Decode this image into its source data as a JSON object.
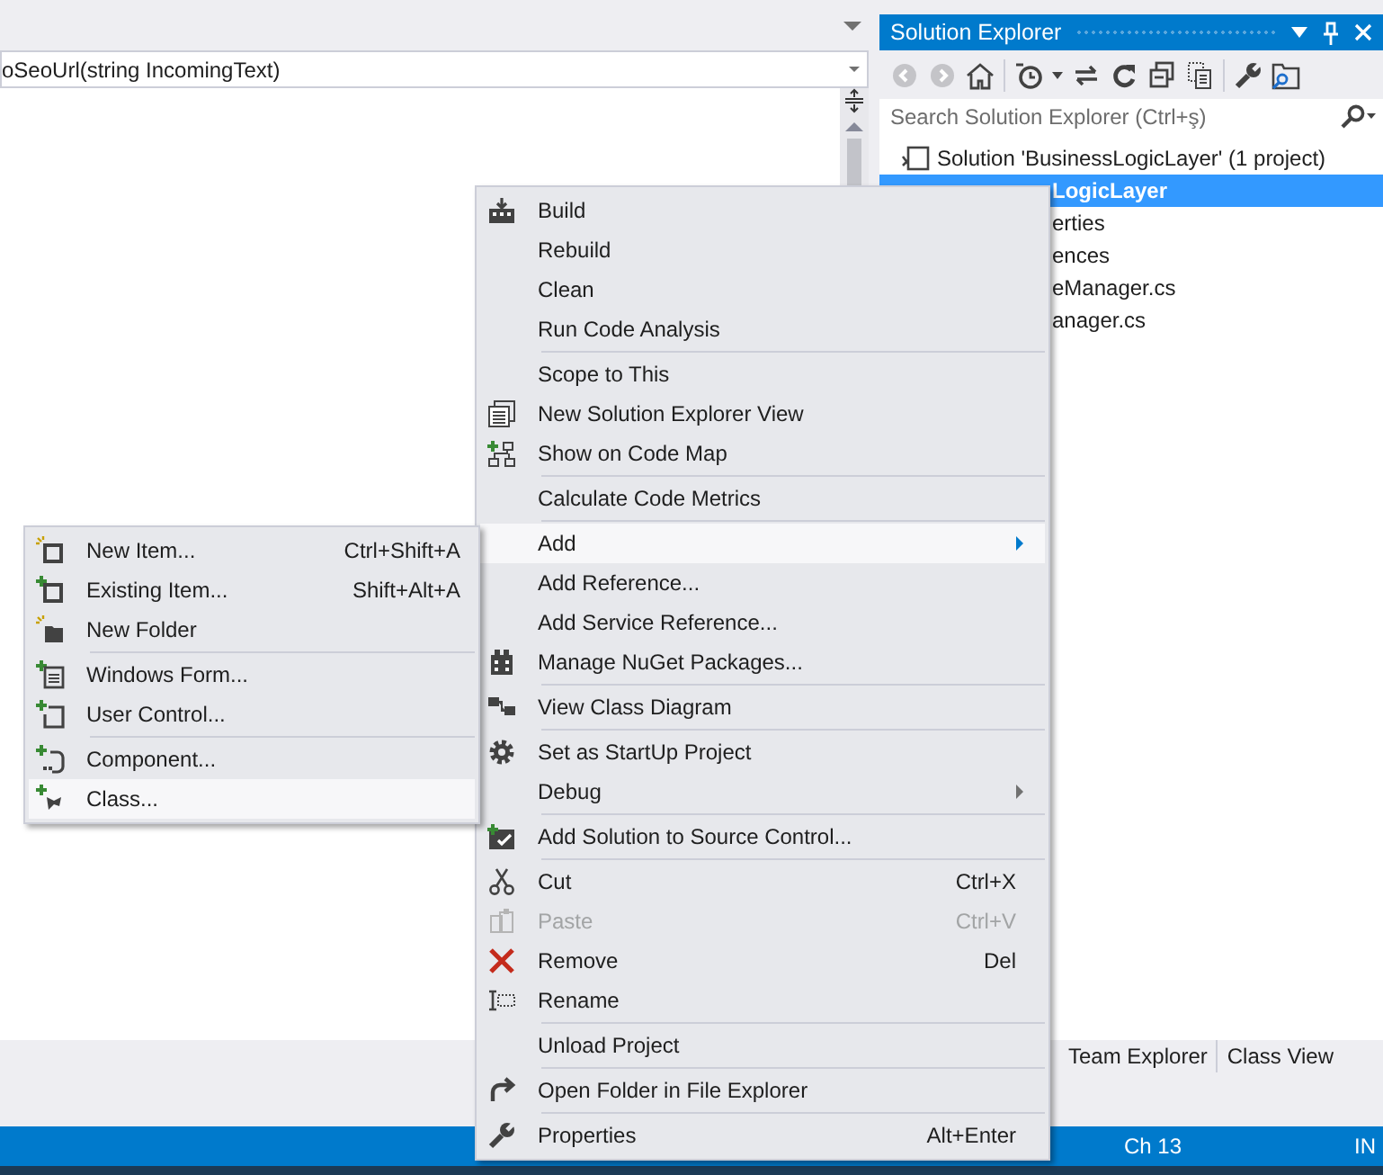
{
  "editor": {
    "nav_combo": "oSeoUrl(string IncomingText)"
  },
  "solution_explorer": {
    "title": "Solution Explorer",
    "search": {
      "placeholder": "Search Solution Explorer (Ctrl+ş)"
    },
    "tree": [
      {
        "kind": "solution",
        "label": "Solution 'BusinessLogicLayer' (1 project)",
        "selected": false
      },
      {
        "kind": "fragment",
        "label": "LogicLayer",
        "selected": true
      },
      {
        "kind": "fragment",
        "label": "erties",
        "selected": false
      },
      {
        "kind": "fragment",
        "label": "ences",
        "selected": false
      },
      {
        "kind": "fragment",
        "label": "eManager.cs",
        "selected": false
      },
      {
        "kind": "fragment",
        "label": "anager.cs",
        "selected": false
      }
    ],
    "bottom_tabs": [
      "Team Explorer",
      "Class View"
    ]
  },
  "context_menu": [
    [
      {
        "label": "Build",
        "selected": false,
        "disabled": false,
        "has_submenu": false
      },
      {
        "label": "Rebuild",
        "selected": false,
        "disabled": false,
        "has_submenu": false
      },
      {
        "label": "Clean",
        "selected": false,
        "disabled": false,
        "has_submenu": false
      },
      {
        "label": "Run Code Analysis",
        "selected": false,
        "disabled": false,
        "has_submenu": false
      }
    ],
    [
      {
        "label": "Scope to This",
        "selected": false,
        "disabled": false,
        "has_submenu": false
      },
      {
        "label": "New Solution Explorer View",
        "selected": false,
        "disabled": false,
        "has_submenu": false
      },
      {
        "label": "Show on Code Map",
        "selected": false,
        "disabled": false,
        "has_submenu": false
      }
    ],
    [
      {
        "label": "Calculate Code Metrics",
        "selected": false,
        "disabled": false,
        "has_submenu": false
      }
    ],
    [
      {
        "label": "Add",
        "selected": true,
        "disabled": false,
        "has_submenu": true
      },
      {
        "label": "Add Reference...",
        "selected": false,
        "disabled": false,
        "has_submenu": false
      },
      {
        "label": "Add Service Reference...",
        "selected": false,
        "disabled": false,
        "has_submenu": false
      },
      {
        "label": "Manage NuGet Packages...",
        "selected": false,
        "disabled": false,
        "has_submenu": false
      }
    ],
    [
      {
        "label": "View Class Diagram",
        "selected": false,
        "disabled": false,
        "has_submenu": false
      }
    ],
    [
      {
        "label": "Set as StartUp Project",
        "selected": false,
        "disabled": false,
        "has_submenu": false
      },
      {
        "label": "Debug",
        "selected": false,
        "disabled": false,
        "has_submenu": true
      }
    ],
    [
      {
        "label": "Add Solution to Source Control...",
        "selected": false,
        "disabled": false,
        "has_submenu": false
      }
    ],
    [
      {
        "label": "Cut",
        "shortcut": "Ctrl+X",
        "selected": false,
        "disabled": false,
        "has_submenu": false
      },
      {
        "label": "Paste",
        "shortcut": "Ctrl+V",
        "selected": false,
        "disabled": true,
        "has_submenu": false
      },
      {
        "label": "Remove",
        "shortcut": "Del",
        "selected": false,
        "disabled": false,
        "has_submenu": false
      },
      {
        "label": "Rename",
        "selected": false,
        "disabled": false,
        "has_submenu": false
      }
    ],
    [
      {
        "label": "Unload Project",
        "selected": false,
        "disabled": false,
        "has_submenu": false
      }
    ],
    [
      {
        "label": "Open Folder in File Explorer",
        "selected": false,
        "disabled": false,
        "has_submenu": false
      }
    ],
    [
      {
        "label": "Properties",
        "shortcut": "Alt+Enter",
        "selected": false,
        "disabled": false,
        "has_submenu": false
      }
    ]
  ],
  "add_submenu": [
    [
      {
        "label": "New Item...",
        "shortcut": "Ctrl+Shift+A",
        "selected": false
      },
      {
        "label": "Existing Item...",
        "shortcut": "Shift+Alt+A",
        "selected": false
      },
      {
        "label": "New Folder",
        "selected": false
      }
    ],
    [
      {
        "label": "Windows Form...",
        "selected": false
      },
      {
        "label": "User Control...",
        "selected": false
      }
    ],
    [
      {
        "label": "Component...",
        "selected": false
      },
      {
        "label": "Class...",
        "selected": true
      }
    ]
  ],
  "status_bar": {
    "column": "Ch 13",
    "mode": "IN"
  }
}
